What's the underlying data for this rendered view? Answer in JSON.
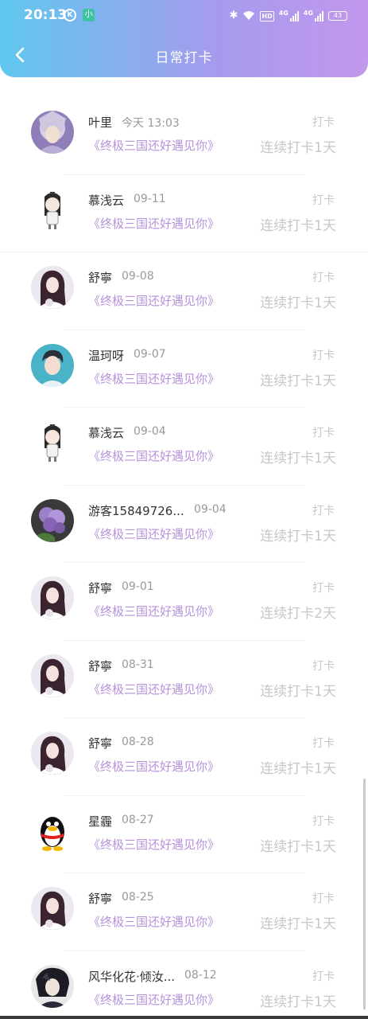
{
  "status_bar": {
    "time": "20:13",
    "k_icon": "K",
    "app_icon": "小",
    "bluetooth": "✱",
    "wifi": "◔",
    "hd": "HD",
    "net1": "4G",
    "net2": "4G",
    "battery": "43"
  },
  "header": {
    "title": "日常打卡",
    "back_icon": "chevron-left-icon",
    "gradient": [
      "#5fc8ee",
      "#c198ec"
    ]
  },
  "action_label": "打卡",
  "items": [
    {
      "name": "叶里",
      "time": "今天 13:03",
      "game": "《终极三国还好遇见你》",
      "streak": "连续打卡1天",
      "avatar": "avatar-warrior"
    },
    {
      "name": "慕浅云",
      "time": "09-11",
      "game": "《终极三国还好遇见你》",
      "streak": "连续打卡1天",
      "avatar": "avatar-chibi"
    },
    {
      "name": "舒寧",
      "time": "09-08",
      "game": "《终极三国还好遇见你》",
      "streak": "连续打卡1天",
      "avatar": "avatar-girl"
    },
    {
      "name": "温珂呀",
      "time": "09-07",
      "game": "《终极三国还好遇见你》",
      "streak": "连续打卡1天",
      "avatar": "avatar-boy"
    },
    {
      "name": "慕浅云",
      "time": "09-04",
      "game": "《终极三国还好遇见你》",
      "streak": "连续打卡1天",
      "avatar": "avatar-chibi"
    },
    {
      "name": "游客15849726...",
      "time": "09-04",
      "game": "《终极三国还好遇见你》",
      "streak": "连续打卡1天",
      "avatar": "avatar-flower"
    },
    {
      "name": "舒寧",
      "time": "09-01",
      "game": "《终极三国还好遇见你》",
      "streak": "连续打卡2天",
      "avatar": "avatar-girl"
    },
    {
      "name": "舒寧",
      "time": "08-31",
      "game": "《终极三国还好遇见你》",
      "streak": "连续打卡1天",
      "avatar": "avatar-girl"
    },
    {
      "name": "舒寧",
      "time": "08-28",
      "game": "《终极三国还好遇见你》",
      "streak": "连续打卡1天",
      "avatar": "avatar-girl"
    },
    {
      "name": "星霾",
      "time": "08-27",
      "game": "《终极三国还好遇见你》",
      "streak": "连续打卡1天",
      "avatar": "avatar-penguin"
    },
    {
      "name": "舒寧",
      "time": "08-25",
      "game": "《终极三国还好遇见你》",
      "streak": "连续打卡1天",
      "avatar": "avatar-girl"
    },
    {
      "name": "风华化花·倾汝...",
      "time": "08-12",
      "game": "《终极三国还好遇见你》",
      "streak": "连续打卡1天",
      "avatar": "avatar-dark-hero"
    }
  ]
}
